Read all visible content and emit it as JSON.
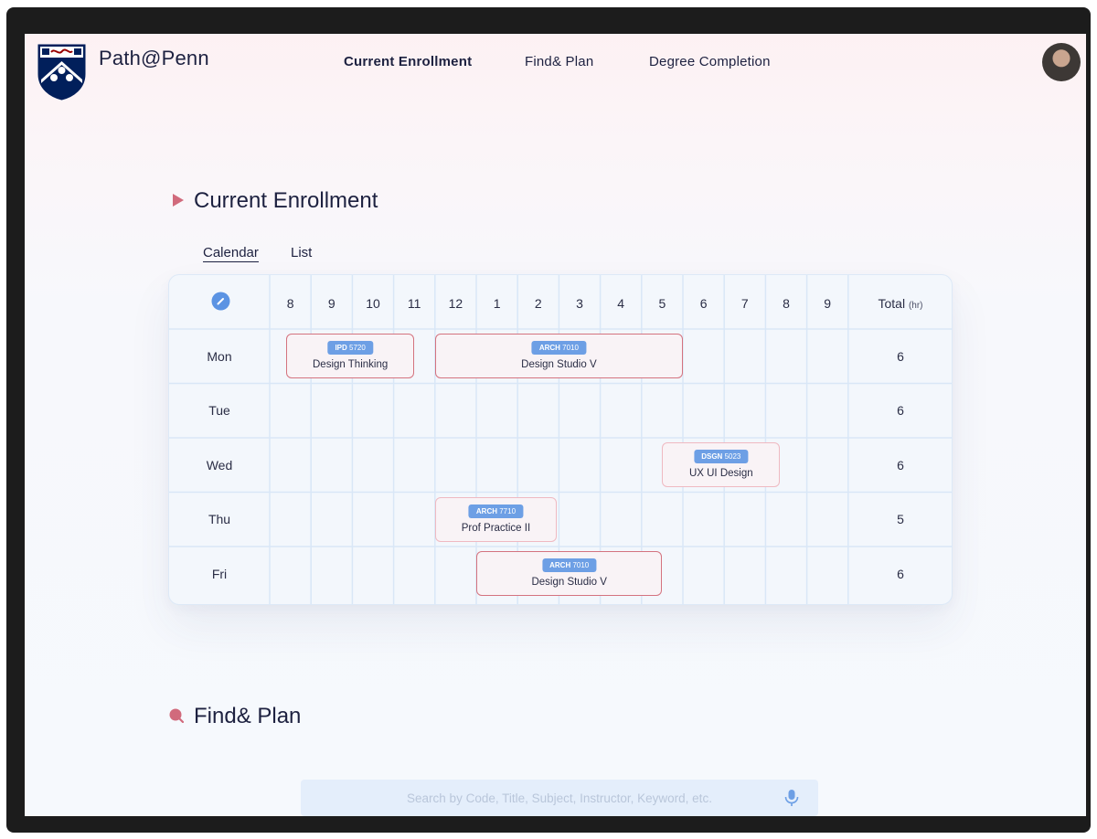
{
  "header": {
    "brand": "Path@Penn",
    "nav": [
      {
        "label": "Current Enrollment",
        "active": true
      },
      {
        "label": "Find& Plan",
        "active": false
      },
      {
        "label": "Degree Completion",
        "active": false
      }
    ]
  },
  "enrollment": {
    "title": "Current Enrollment",
    "tabs": [
      {
        "label": "Calendar",
        "active": true
      },
      {
        "label": "List",
        "active": false
      }
    ],
    "hours": [
      "8",
      "9",
      "10",
      "11",
      "12",
      "1",
      "2",
      "3",
      "4",
      "5",
      "6",
      "7",
      "8",
      "9"
    ],
    "total_label": "Total",
    "total_unit": "(hr)",
    "days": [
      {
        "name": "Mon",
        "total": "6"
      },
      {
        "name": "Tue",
        "total": "6"
      },
      {
        "name": "Wed",
        "total": "6"
      },
      {
        "name": "Thu",
        "total": "5"
      },
      {
        "name": "Fri",
        "total": "6"
      }
    ],
    "courses": [
      {
        "dept": "IPD",
        "num": "5720",
        "name": "Design Thinking",
        "day": 0,
        "start": 0.4,
        "end": 3.5,
        "highlight": true
      },
      {
        "dept": "ARCH",
        "num": "7010",
        "name": "Design Studio V",
        "day": 0,
        "start": 4.0,
        "end": 10.0,
        "highlight": true
      },
      {
        "dept": "DSGN",
        "num": "5023",
        "name": "UX UI Design",
        "day": 2,
        "start": 9.5,
        "end": 12.35,
        "highlight": false
      },
      {
        "dept": "ARCH",
        "num": "7710",
        "name": "Prof Practice II",
        "day": 3,
        "start": 4.0,
        "end": 6.95,
        "highlight": false
      },
      {
        "dept": "ARCH",
        "num": "7010",
        "name": "Design Studio V",
        "day": 4,
        "start": 5.0,
        "end": 9.5,
        "highlight": true
      }
    ]
  },
  "find_plan": {
    "title": "Find& Plan",
    "search_placeholder": "Search by Code, Title, Subject, Instructor, Keyword, etc."
  },
  "colors": {
    "accent": "#d16a7c",
    "badge": "#6d9fe5",
    "course_border": "#d4737f",
    "grid_line": "#d9e7f7"
  }
}
